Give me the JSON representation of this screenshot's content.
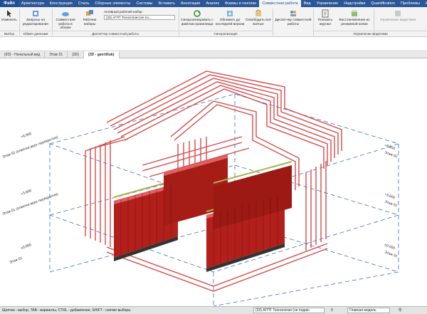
{
  "ribbon_tabs": [
    "Файл",
    "Архитектура",
    "Конструкция",
    "Сталь",
    "Сборные элементы",
    "Системы",
    "Вставить",
    "Аннотации",
    "Анализ",
    "Формы и генплан",
    "Совместная работа",
    "Вид",
    "Управление",
    "Надстройки",
    "Quantification",
    "Проблемы",
    "Инструм"
  ],
  "active_tab": "Совместная работа",
  "ribbon": {
    "modify": "Изменить",
    "panel_select": "Выбор",
    "edit_request": "Запросы на редактирование",
    "panel_exchange": "Обмен данными",
    "collab_cloud": "Совместная работа в облаке",
    "worksets": "Рабочие наборы",
    "active_workset_label": "Активный рабочий набор",
    "active_workset_value": "(33) АГПТ Технологии (не по...",
    "panel_manage_collab": "Диспетчер совместной работы",
    "sync_central": "Синхронизировать с файлом хранилища",
    "reload_latest": "Обновить до последней версии",
    "relinquish": "Освободить все взятые",
    "panel_sync": "Синхронизация",
    "collab_manager": "Диспетчер совместной работы",
    "show_history": "Показать журнал",
    "restore_backup": "Восстановление из резервной копии",
    "manage_models": "Управление моделями",
    "panel_manage_models": "Управление моделями"
  },
  "view_tabs": [
    {
      "label": "{0D} - Начальный вид"
    },
    {
      "label": "Этаж 01"
    },
    {
      "label": "{3D}"
    },
    {
      "label": "{3D - gavrilliuk}"
    }
  ],
  "level_labels": [
    {
      "elev": "+6.950",
      "name": "Этаж 02 (отметка верх перекрытия)"
    },
    {
      "elev": "+3.600",
      "name": "Этаж 01 (отметка верх перекрытия)"
    },
    {
      "elev": "±0.000",
      "name": "Этаж 01"
    },
    {
      "elev": "+6.950",
      "name": "Этаж 02"
    },
    {
      "elev": "+3.600",
      "name": "Этаж 01"
    },
    {
      "elev": "±0.000",
      "name": "Этаж 01"
    }
  ],
  "status": {
    "hint": "Щелчок - выбор, TAB - варианты, CTRL - добавление, SHIFT - снятие выбора.",
    "workset": "(33) АГПТ Технологии (не подаю",
    "model": "Главная модель",
    "zero": "0"
  },
  "colors": {
    "ribbon_tab_bg": "#2b5797",
    "pipe": "#d44a4a",
    "cylinder": "#b3201b",
    "grid": "#3c6ebf"
  }
}
